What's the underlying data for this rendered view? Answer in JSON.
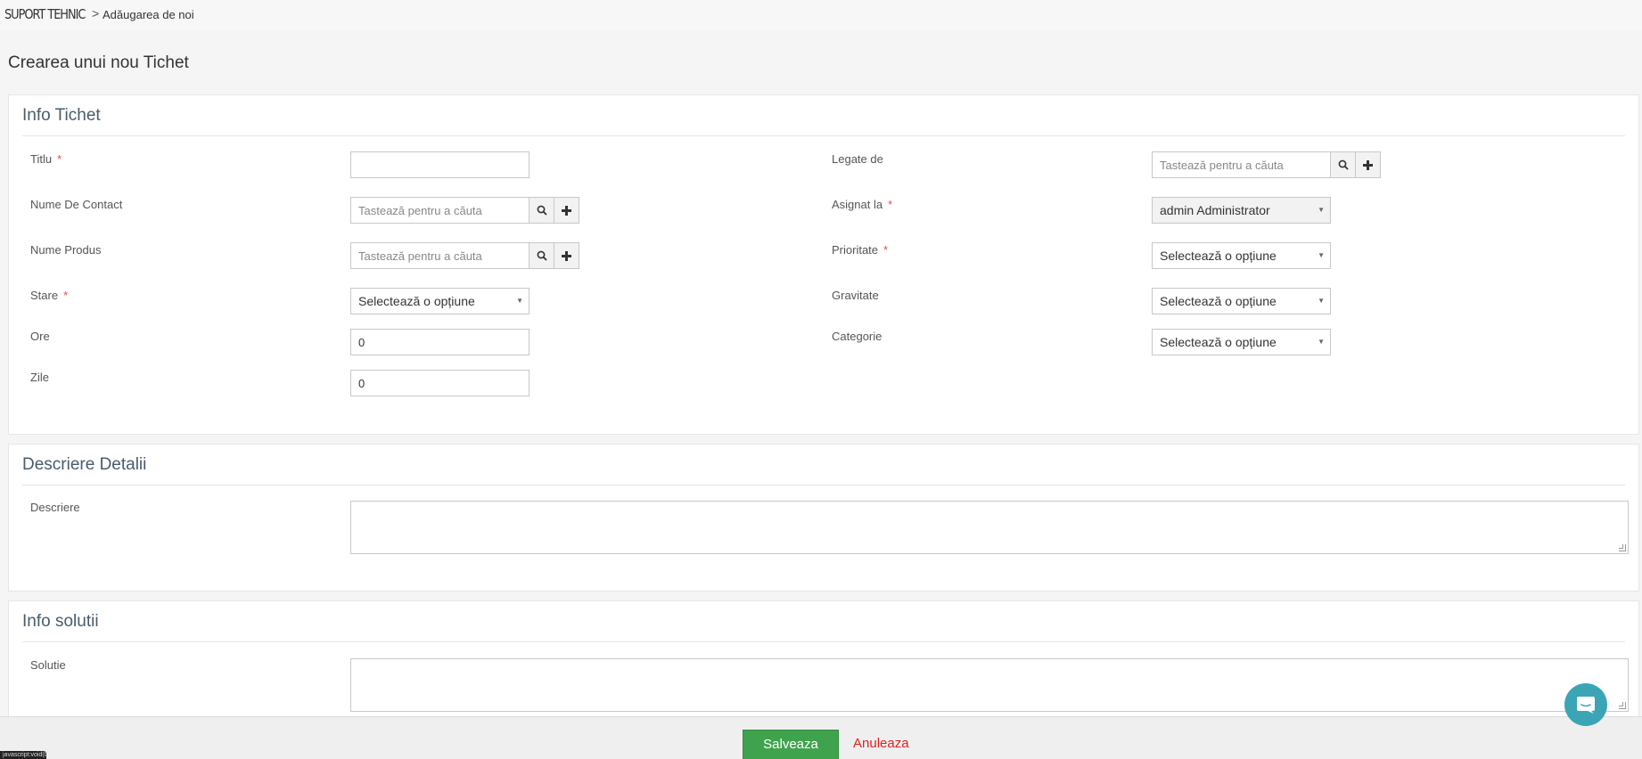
{
  "breadcrumb": {
    "module": "SUPORT TEHNIC",
    "separator": ">",
    "current": "Adăugarea de noi"
  },
  "page_title": "Crearea unui nou Tichet",
  "info_tichet": {
    "title": "Info Tichet",
    "titlu_label": "Titlu",
    "titlu_value": "",
    "legate_de_label": "Legate de",
    "legate_de_placeholder": "Tastează pentru a căuta",
    "nume_contact_label": "Nume De Contact",
    "nume_contact_placeholder": "Tastează pentru a căuta",
    "asignat_la_label": "Asignat la",
    "asignat_la_value": "admin Administrator",
    "nume_produs_label": "Nume Produs",
    "nume_produs_placeholder": "Tastează pentru a căuta",
    "prioritate_label": "Prioritate",
    "prioritate_value": "Selectează o opțiune",
    "stare_label": "Stare",
    "stare_value": "Selectează o opțiune",
    "gravitate_label": "Gravitate",
    "gravitate_value": "Selectează o opțiune",
    "ore_label": "Ore",
    "ore_value": "0",
    "categorie_label": "Categorie",
    "categorie_value": "Selectează o opțiune",
    "zile_label": "Zile",
    "zile_value": "0",
    "required_mark": "*"
  },
  "descriere_detalii": {
    "title": "Descriere Detalii",
    "descriere_label": "Descriere",
    "descriere_value": ""
  },
  "info_solutii": {
    "title": "Info solutii",
    "solutie_label": "Solutie",
    "solutie_value": ""
  },
  "footer": {
    "save_label": "Salveaza",
    "cancel_label": "Anuleaza"
  },
  "corner_tag": "javascript:void(0)",
  "colors": {
    "save_button": "#3fa34d",
    "cancel_link": "#e02020",
    "required": "#d9534f",
    "chat_bubble": "#3ba5b5",
    "panel_title": "#4a5b6c"
  },
  "icons": {
    "search": "search-icon",
    "add": "plus-icon",
    "dropdown": "caret-down-icon",
    "chat": "chat-icon"
  }
}
